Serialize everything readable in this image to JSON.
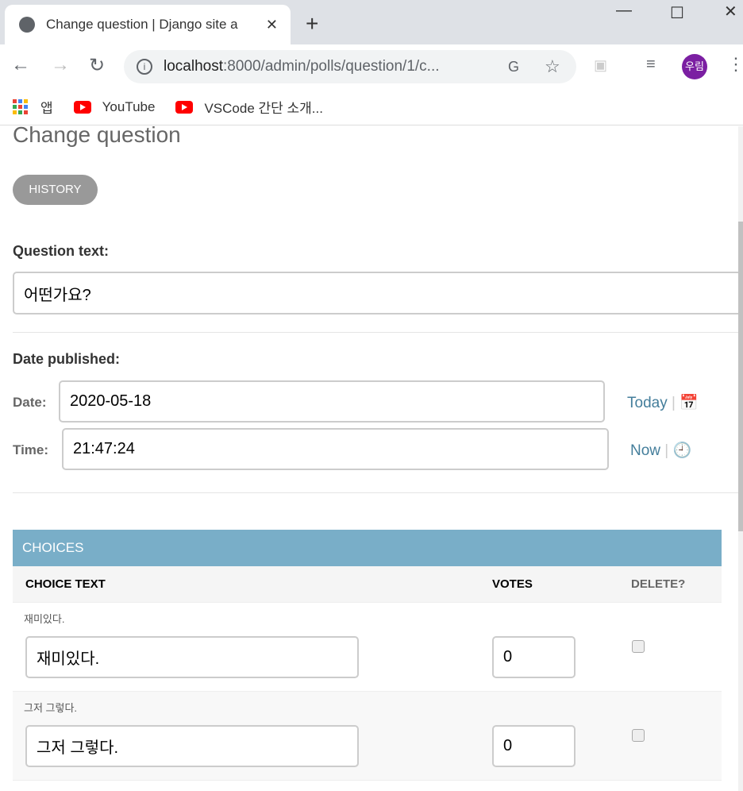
{
  "browser": {
    "tab_title": "Change question | Django site a",
    "url_host": "localhost",
    "url_rest": ":8000/admin/polls/question/1/c...",
    "profile": "우림",
    "bookmarks": [
      {
        "label": "앱"
      },
      {
        "label": "YouTube"
      },
      {
        "label": "VSCode 간단 소개..."
      }
    ]
  },
  "page": {
    "title": "Change question",
    "history": "HISTORY",
    "question_label": "Question text:",
    "question_value": "어떤가요?",
    "date_published_label": "Date published:",
    "date_label": "Date:",
    "date_value": "2020-05-18",
    "today": "Today",
    "time_label": "Time:",
    "time_value": "21:47:24",
    "now": "Now",
    "sep": "|"
  },
  "choices": {
    "title": "CHOICES",
    "headers": {
      "text": "CHOICE TEXT",
      "votes": "VOTES",
      "delete": "DELETE?"
    },
    "rows": [
      {
        "original": "재미있다.",
        "text": "재미있다.",
        "votes": "0"
      },
      {
        "original": "그저 그렇다.",
        "text": "그저 그렇다.",
        "votes": "0"
      }
    ]
  }
}
